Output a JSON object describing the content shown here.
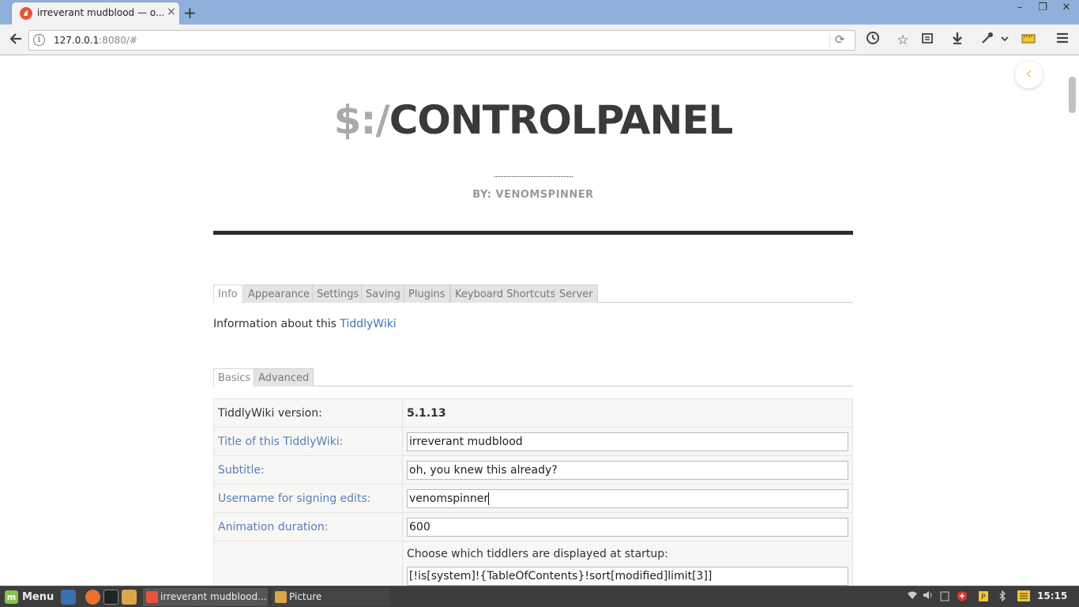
{
  "browser": {
    "tab_title": "irreverant mudblood — o...",
    "tab_close": "×",
    "new_tab": "+",
    "url_host": "127.0.0.1",
    "url_rest": ":8080/#",
    "window_controls": [
      "–",
      "❐",
      "✕"
    ],
    "toolbar_icons": [
      "history-icon",
      "star-icon",
      "reading-list-icon",
      "download-icon",
      "extension-icon",
      "dropdown-icon",
      "ruler-icon",
      "hamburger-menu-icon"
    ]
  },
  "page": {
    "title_prefix": "$:/",
    "title_main": "CONTROLPANEL",
    "byline": "BY: VENOMSPINNER",
    "collapse_glyph": "‹",
    "main_tabs": [
      {
        "label": "Info",
        "active": true
      },
      {
        "label": "Appearance",
        "active": false
      },
      {
        "label": "Settings",
        "active": false
      },
      {
        "label": "Saving",
        "active": false
      },
      {
        "label": "Plugins",
        "active": false
      },
      {
        "label": "Keyboard Shortcuts",
        "active": false
      },
      {
        "label": "Server",
        "active": false
      }
    ],
    "info_text": "Information about this ",
    "info_link": "TiddlyWiki",
    "sub_tabs": [
      {
        "label": "Basics",
        "active": true
      },
      {
        "label": "Advanced",
        "active": false
      }
    ],
    "rows": {
      "version_label": "TiddlyWiki version:",
      "version_value": "5.1.13",
      "title_label": "Title of this TiddlyWiki:",
      "title_value": "irreverant mudblood",
      "subtitle_label": "Subtitle:",
      "subtitle_value": "oh, you knew this already?",
      "username_label": "Username for signing edits:",
      "username_value": "venomspinner",
      "animation_label": "Animation duration:",
      "animation_value": "600",
      "startup_label": "Choose which tiddlers are displayed at startup:",
      "startup_value": "[!is[system]!{TableOfContents}!sort[modified]limit[3]]"
    }
  },
  "taskbar": {
    "menu_label": "Menu",
    "tasks": [
      {
        "label": "irreverant mudblood..."
      },
      {
        "label": "Picture"
      }
    ],
    "clock": "15:15"
  }
}
